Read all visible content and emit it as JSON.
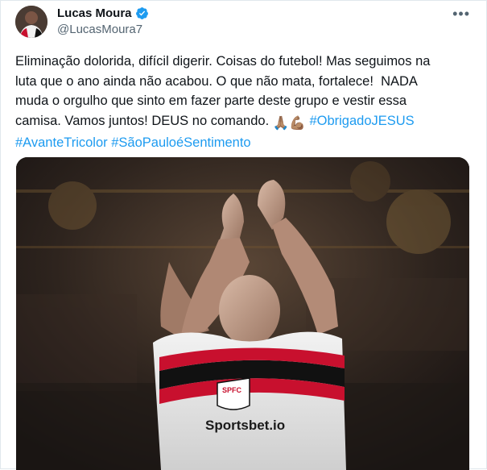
{
  "author": {
    "name": "Lucas Moura",
    "handle": "@LucasMoura7",
    "verified": true
  },
  "tweet": {
    "line1": "Eliminação dolorida, difícil digerir. Coisas do futebol! Mas seguimos na",
    "line2": "luta que o ano ainda não acabou. O que não mata, fortalece!  NADA",
    "line3": "muda o orgulho que sinto em fazer parte deste grupo e vestir essa",
    "line4": "camisa. Vamos juntos! DEUS no comando. ",
    "emoji": "🙏🏽💪🏽",
    "hashtag1": "#ObrigadoJESUS",
    "hashtag2": "#AvanteTricolor",
    "hashtag3": "#SãoPauloéSentimento"
  },
  "media": {
    "crest_text": "SPFC",
    "sponsor_text": "Sportsbet.io"
  },
  "colors": {
    "hashtag": "#1d9bf0",
    "verified": "#1d9bf0",
    "text": "#0f1419",
    "muted": "#536471"
  },
  "icons": [
    "verified-badge-icon",
    "more-options-icon"
  ]
}
